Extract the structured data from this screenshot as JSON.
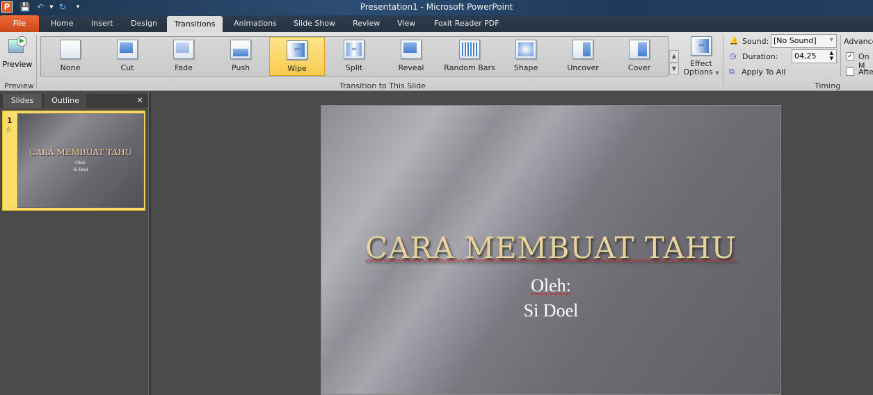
{
  "window": {
    "title": "Presentation1  -  Microsoft PowerPoint"
  },
  "quick_access": {
    "app_icon": "P",
    "save": "save-icon",
    "undo": "undo-icon",
    "redo": "redo-icon",
    "customize": "customize-icon"
  },
  "tabs": [
    "File",
    "Home",
    "Insert",
    "Design",
    "Transitions",
    "Animations",
    "Slide Show",
    "Review",
    "View",
    "Foxit Reader PDF"
  ],
  "active_tab": "Transitions",
  "ribbon": {
    "preview": {
      "button": "Preview",
      "group": "Preview"
    },
    "gallery": {
      "group": "Transition to This Slide",
      "items": [
        "None",
        "Cut",
        "Fade",
        "Push",
        "Wipe",
        "Split",
        "Reveal",
        "Random Bars",
        "Shape",
        "Uncover",
        "Cover"
      ],
      "selected": "Wipe"
    },
    "effect_options": {
      "line1": "Effect",
      "line2": "Options"
    },
    "timing": {
      "sound_label": "Sound:",
      "sound_value": "[No Sound]",
      "duration_label": "Duration:",
      "duration_value": "04,25",
      "apply_all": "Apply To All",
      "group": "Timing",
      "advance_label": "Advance",
      "on_click": "On M",
      "after": "Afte",
      "on_click_checked": true,
      "after_checked": false
    }
  },
  "panel": {
    "tabs": [
      "Slides",
      "Outline"
    ],
    "close": "✕",
    "slide_number": "1",
    "star": "☆"
  },
  "slide": {
    "title": "CARA MEMBUAT TAHU",
    "line1": "Oleh:",
    "line2": "Si Doel"
  }
}
